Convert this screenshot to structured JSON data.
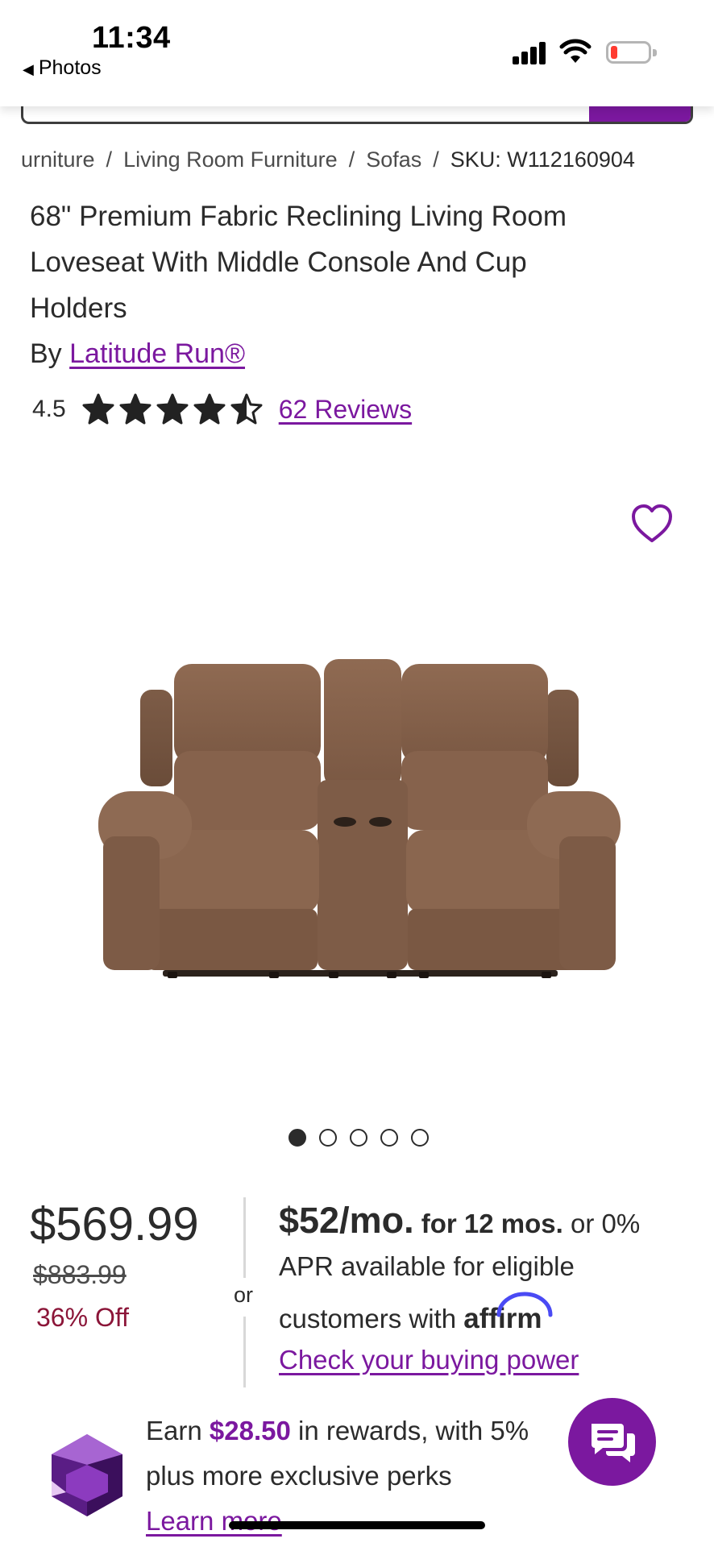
{
  "status_bar": {
    "time": "11:34",
    "back_label": "Photos",
    "battery_color": "#ff3b30"
  },
  "colors": {
    "brand_purple": "#7b189f",
    "discount_red": "#8b1538",
    "text": "#2b2b2b"
  },
  "breadcrumb": {
    "items": [
      "urniture",
      "Living Room Furniture",
      "Sofas"
    ],
    "separator": "/",
    "sku": "SKU: W112160904"
  },
  "product": {
    "title_lines": [
      "68\" Premium Fabric Reclining Living Room",
      "Loveseat With Middle Console And Cup",
      "Holders"
    ],
    "by_label": "By",
    "brand": "Latitude Run®",
    "rating": "4.5",
    "rating_stars": 4.5,
    "rating_max": 5,
    "reviews_label": "62 Reviews",
    "image_icon": "brown-fabric-reclining-loveseat",
    "favorite_icon": "heart-outline-icon"
  },
  "carousel": {
    "count": 5,
    "active_index": 0
  },
  "pricing": {
    "price": "$569.99",
    "was_price": "$883.99",
    "discount": "36% Off",
    "or_label": "or"
  },
  "financing": {
    "amount": "$52/mo.",
    "terms": "for 12 mos.",
    "text_1": "or 0%",
    "text_2": "APR available for eligible",
    "text_3": "customers with",
    "affirm_logo": "affirm",
    "link": "Check your buying power"
  },
  "rewards": {
    "prefix": "Earn",
    "amount": "$28.50",
    "suffix": "in rewards, with 5%",
    "line2": "plus more exclusive perks",
    "link": "Learn more",
    "icon": "purple-gem-icon"
  },
  "chat": {
    "icon": "chat-bubbles-icon"
  }
}
